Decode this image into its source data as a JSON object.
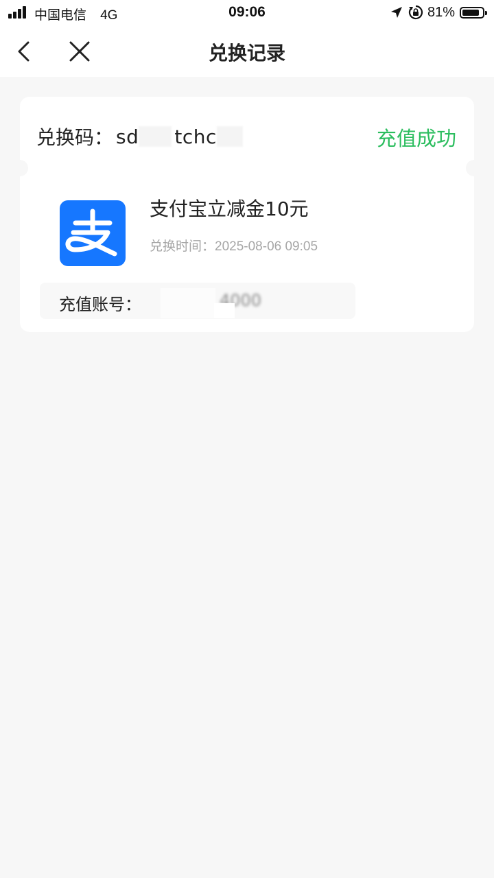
{
  "status_bar": {
    "carrier": "中国电信",
    "network": "4G",
    "time": "09:06",
    "battery_percent": "81%",
    "battery_level": 0.81
  },
  "nav": {
    "title": "兑换记录",
    "back_icon": "chevron-left-icon",
    "close_icon": "close-icon"
  },
  "record": {
    "code_label": "兑换码：",
    "code_value_start": "sd",
    "code_value_mid": "tchc",
    "status": "充值成功",
    "status_color": "#2bbd5e",
    "product_icon": "alipay-logo",
    "product_icon_color": "#1677ff",
    "product_name": "支付宝立减金10元",
    "time_label": "兑换时间：",
    "time_value": "2025-08-06 09:05",
    "account_label": "充值账号：",
    "account_value": "4000"
  }
}
